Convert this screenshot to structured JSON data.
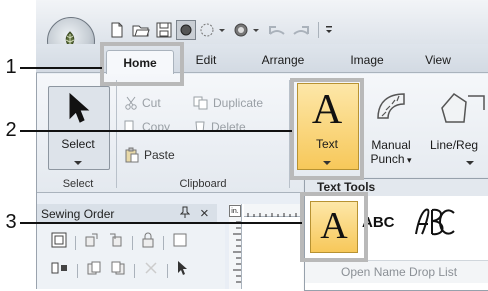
{
  "callouts": [
    "1",
    "2",
    "3"
  ],
  "tabs": {
    "home": "Home",
    "edit": "Edit",
    "arrange": "Arrange",
    "image": "Image",
    "view": "View"
  },
  "select_group": {
    "button_label": "Select",
    "group_label": "Select"
  },
  "clipboard": {
    "cut": "Cut",
    "duplicate": "Duplicate",
    "copy": "Copy",
    "delete": "Delete",
    "paste": "Paste",
    "group_label": "Clipboard"
  },
  "text_button": {
    "glyph": "A",
    "label": "Text"
  },
  "manual_punch": {
    "line1": "Manual",
    "line2": "Punch"
  },
  "line_region": {
    "label": "Line/Reg"
  },
  "text_tools": {
    "header": "Text Tools",
    "abc": "ABC",
    "glyph": "A",
    "footer": "Open Name Drop List"
  },
  "sewing_order": {
    "title": "Sewing Order",
    "pin": "ᵖ",
    "close": "×"
  },
  "ruler": {
    "unit": "in."
  }
}
